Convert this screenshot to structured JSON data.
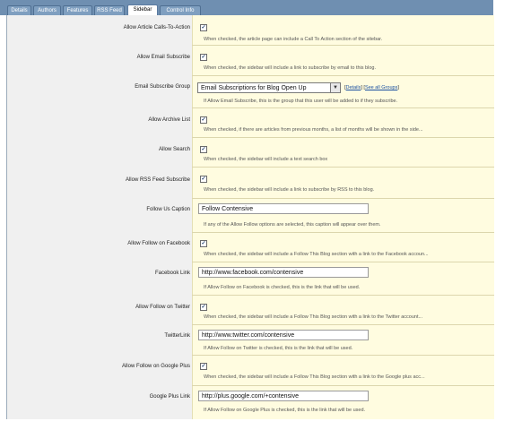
{
  "tabs": [
    {
      "label": "Details",
      "active": false
    },
    {
      "label": "Authors",
      "active": false
    },
    {
      "label": "Features",
      "active": false
    },
    {
      "label": "RSS Feed",
      "active": false
    },
    {
      "label": "Sidebar",
      "active": true
    },
    {
      "label": "Control Info",
      "active": false
    }
  ],
  "rows": {
    "calls_to_action": {
      "label": "Allow Article Calls-To-Action",
      "checked": true,
      "help": "When checked, the article page can include a Call To Action section of the sitebar."
    },
    "email_subscribe": {
      "label": "Allow Email Subscribe",
      "checked": true,
      "help": "When checked, the sidebar will include a link to subscribe by email to this blog."
    },
    "email_group": {
      "label": "Email Subscribe Group",
      "value": "Email Subscriptions for Blog Open Up",
      "arrow": "▼",
      "link_prefix": "[",
      "details_link": "Details",
      "separator": "] [",
      "see_all_link": "See all Groups",
      "link_suffix": "]",
      "help": "If Allow Email Subscribe, this is the group that this user will be added to if they subscribe."
    },
    "archive_list": {
      "label": "Allow Archive List",
      "checked": true,
      "help": "When checked, if there are articles from previous months, a list of months will be shown in the side..."
    },
    "search": {
      "label": "Allow Search",
      "checked": true,
      "help": "When checked, the sidebar will include a text search box"
    },
    "rss_subscribe": {
      "label": "Allow RSS Feed Subscribe",
      "checked": true,
      "help": "When checked, the sidebar will include a link to subscribe by RSS to this blog."
    },
    "follow_caption": {
      "label": "Follow Us Caption",
      "value": "Follow Contensive",
      "help": "If any of the Allow Follow options are selected, this caption will appear over them."
    },
    "follow_facebook": {
      "label": "Allow Follow on Facebook",
      "checked": true,
      "help": "When checked, the sidebar will include a Follow This Blog section with a link to the Facebook accoun..."
    },
    "facebook_link": {
      "label": "Facebook Link",
      "value": "http://www.facebook.com/contensive",
      "help": "If Allow Follow on Facebook is checked, this is the link that will be used."
    },
    "follow_twitter": {
      "label": "Allow Follow on Twitter",
      "checked": true,
      "help": "When checked, the sidebar will include a Follow This Blog section with a link to the Twitter account..."
    },
    "twitter_link": {
      "label": "TwitterLink",
      "value": "http://www.twitter.com/contensive",
      "help": "If Allow Follow on Twitter is checked, this is the link that will be used."
    },
    "follow_google": {
      "label": "Allow Follow on Google Plus",
      "checked": true,
      "help": "When checked, the sidebar will include a Follow This Blog section with a link to the Google plus acc..."
    },
    "google_link": {
      "label": "Google Plus Link",
      "value": "http://plus.google.com/+contensive",
      "help": "If Allow Follow on Google Plus is checked, this is the link that will be used."
    }
  },
  "checkmark": "✓"
}
